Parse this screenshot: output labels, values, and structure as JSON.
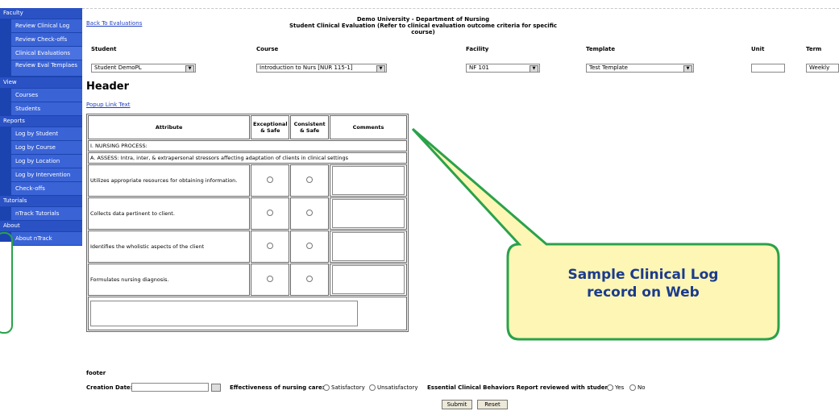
{
  "sidebar": {
    "sections": [
      {
        "label": "Faculty",
        "items": [
          "Review Clinical Log",
          "Review Check-offs",
          "Clinical Evaluations",
          "Review Eval Templaes"
        ]
      },
      {
        "label": "View",
        "items": [
          "Courses",
          "Students"
        ]
      },
      {
        "label": "Reports",
        "items": [
          "Log by Student",
          "Log by Course",
          "Log by Location",
          "Log by Intervention",
          "Check-offs"
        ]
      },
      {
        "label": "Tutorials",
        "items": [
          "nTrack Tutorials"
        ]
      },
      {
        "label": "About",
        "items": [
          "About nTrack"
        ]
      }
    ]
  },
  "page": {
    "back_link": "Back To Evaluations",
    "title_line1": "Demo University - Department of Nursing",
    "title_line2": "Student Clinical Evaluation (Refer to clinical evaluation outcome criteria for specific",
    "title_line3": "course)"
  },
  "form": {
    "student_label": "Student",
    "student_value": "Student DemoPL",
    "course_label": "Course",
    "course_value": "Introduction to Nurs [NUR 115-1]",
    "facility_label": "Facility",
    "facility_value": "NF 101",
    "template_label": "Template",
    "template_value": "Test Template",
    "unit_label": "Unit",
    "unit_value": "",
    "term_label": "Term",
    "term_value": "Weekly"
  },
  "header": "Header",
  "popup_link": "Popup Link Text",
  "table": {
    "col_attribute": "Attribute",
    "col_exceptional": "Exceptional & Safe",
    "col_consistent": "Consistent & Safe",
    "col_comments": "Comments",
    "section1": "I. NURSING PROCESS:",
    "section2": "A. ASSESS: Intra, inter, & extrapersonal stressors affecting adaptation of clients in clinical settings",
    "rows": [
      "Utilizes appropriate resources for obtaining information.",
      "Collects data pertinent to client.",
      "Identifies the wholistic aspects of the client",
      "Formulates nursing diagnosis."
    ]
  },
  "callout": {
    "line1": "Sample Clinical Log",
    "line2": "record on Web",
    "border": "#2aa24a",
    "fill": "#fdf6b5"
  },
  "footer": {
    "label": "footer",
    "creation_date_label": "Creation Date:",
    "effectiveness_label": "Effectiveness of nursing care:",
    "opt_satisfactory": "Satisfactory",
    "opt_unsatisfactory": "Unsatisfactory",
    "behaviors_label": "Essential Clinical Behaviors Report reviewed with student:",
    "opt_yes": "Yes",
    "opt_no": "No",
    "submit": "Submit",
    "reset": "Reset"
  }
}
